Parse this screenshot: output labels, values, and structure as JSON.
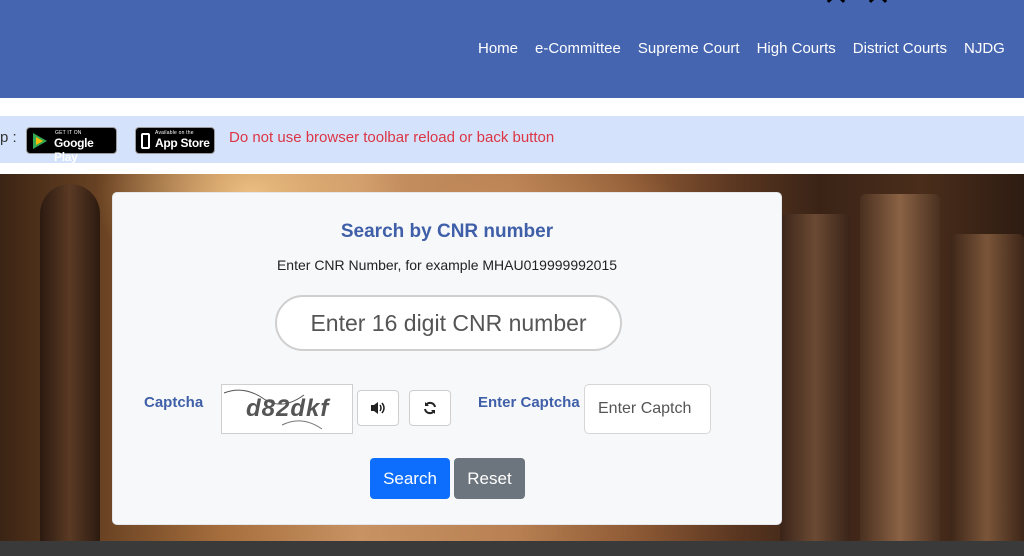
{
  "nav": {
    "items": [
      "Home",
      "e-Committee",
      "Supreme Court",
      "High Courts",
      "District Courts",
      "NJDG"
    ]
  },
  "infobar": {
    "lead": "p :",
    "google_play": {
      "small": "GET IT ON",
      "large": "Google Play"
    },
    "app_store": {
      "small": "Available on the",
      "large": "App Store"
    },
    "warning": "Do not use browser toolbar reload or back button"
  },
  "search_card": {
    "title": "Search by CNR number",
    "subtitle": "Enter CNR Number, for example MHAU019999992015",
    "cnr_placeholder": "Enter 16 digit CNR number",
    "captcha_label": "Captcha",
    "captcha_text": "d82dkf",
    "enter_captcha_label": "Enter Captcha",
    "captcha_placeholder": "Enter Captch",
    "search_label": "Search",
    "reset_label": "Reset"
  },
  "colors": {
    "nav_bg": "#4565b0",
    "info_bg": "#d4e3fb",
    "warning": "#dc3545",
    "title": "#3f5fa8",
    "search_btn": "#0d6efd",
    "reset_btn": "#6c757d"
  },
  "icons": {
    "audio": "volume-icon",
    "refresh": "refresh-icon"
  }
}
